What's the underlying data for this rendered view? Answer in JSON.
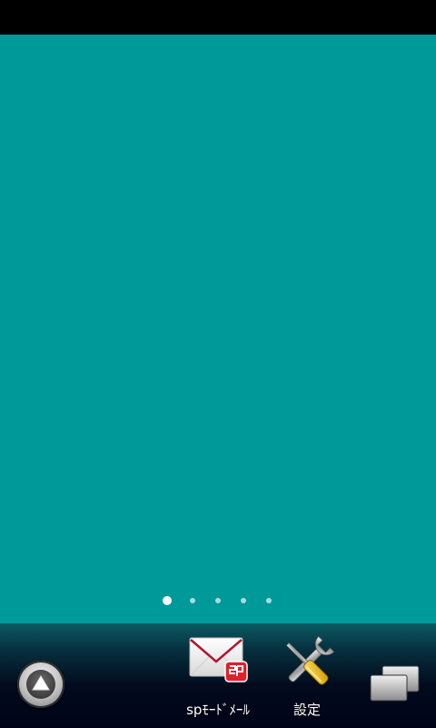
{
  "dock": {
    "apps": [
      {
        "label": "spﾓｰﾄﾞﾒｰﾙ",
        "icon": "sp-mode-mail-icon"
      },
      {
        "label": "設定",
        "icon": "settings-tools-icon"
      }
    ],
    "launcher_icon": "up-triangle-icon",
    "recent_icon": "recent-windows-icon"
  },
  "page_indicator": {
    "pages": 5,
    "current": 1
  },
  "colors": {
    "wallpaper": "#009999",
    "status_bar": "#000000",
    "dock": "#020a1c",
    "sp_badge": "#e0202a"
  }
}
